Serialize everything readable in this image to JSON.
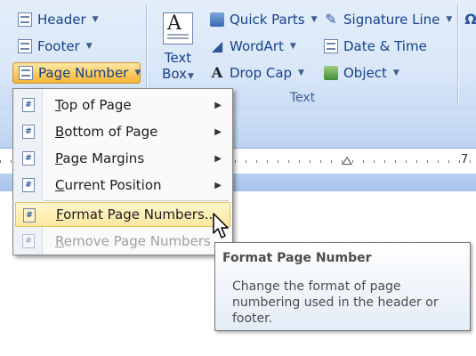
{
  "ribbon": {
    "header_footer": {
      "header_label": "Header",
      "footer_label": "Footer",
      "page_number_label": "Page Number"
    },
    "text_group": {
      "text_box_line1": "Text",
      "text_box_line2": "Box",
      "quick_parts_label": "Quick Parts",
      "wordart_label": "WordArt",
      "drop_cap_label": "Drop Cap",
      "signature_line_label": "Signature Line",
      "date_time_label": "Date & Time",
      "object_label": "Object",
      "group_label": "Text"
    }
  },
  "ruler": {
    "number": "7"
  },
  "menu": {
    "items": [
      {
        "label": "Top of Page",
        "has_submenu": true
      },
      {
        "label": "Bottom of Page",
        "has_submenu": true
      },
      {
        "label": "Page Margins",
        "has_submenu": true
      },
      {
        "label": "Current Position",
        "has_submenu": true
      },
      {
        "label": "Format Page Numbers...",
        "highlighted": true
      },
      {
        "label": "Remove Page Numbers",
        "disabled": true
      }
    ]
  },
  "tooltip": {
    "title": "Format Page Number",
    "body": "Change the format of page numbering used in the header or footer."
  },
  "colors": {
    "ribbon_text": "#15428b",
    "highlight": "#fde8a0",
    "disabled_text": "#a0a0a0"
  }
}
